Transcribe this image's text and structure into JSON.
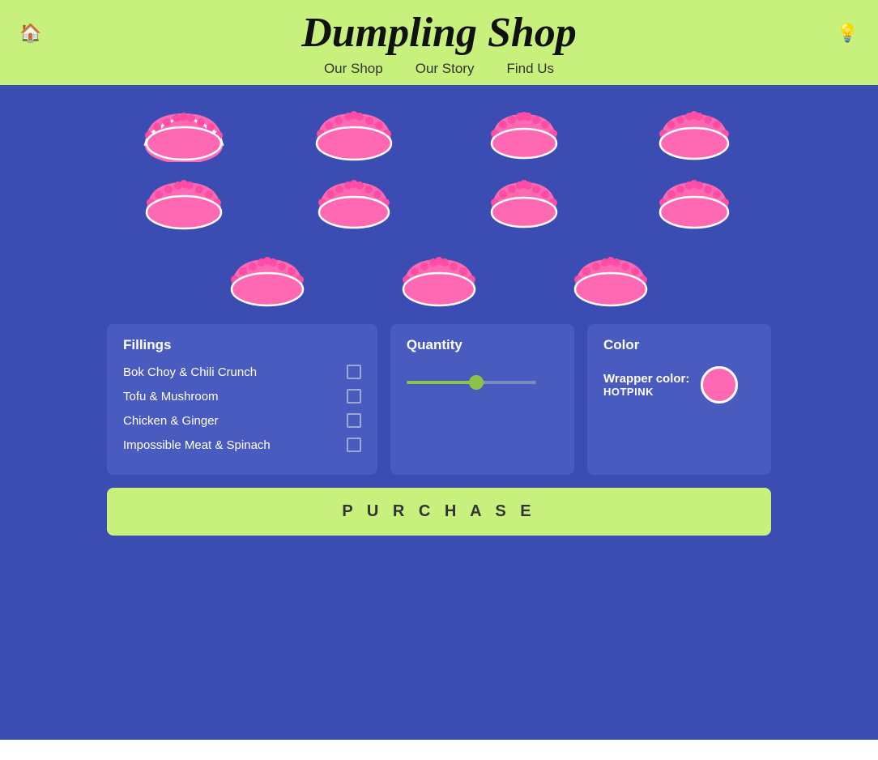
{
  "header": {
    "title": "Dumpling Shop",
    "nav": [
      {
        "label": "Our Shop",
        "href": "#"
      },
      {
        "label": "Our Story",
        "href": "#"
      },
      {
        "label": "Find Us",
        "href": "#"
      }
    ],
    "home_icon": "🏠",
    "light_icon": "💡"
  },
  "dumplings": {
    "count": 11,
    "color": "hotpink"
  },
  "fillings": {
    "title": "Fillings",
    "items": [
      {
        "label": "Bok Choy & Chili Crunch",
        "checked": false
      },
      {
        "label": "Tofu & Mushroom",
        "checked": false
      },
      {
        "label": "Chicken & Ginger",
        "checked": false
      },
      {
        "label": "Impossible Meat & Spinach",
        "checked": false
      }
    ]
  },
  "quantity": {
    "title": "Quantity",
    "value": 7,
    "min": 1,
    "max": 12
  },
  "color": {
    "title": "Color",
    "wrapper_color_label": "Wrapper color:",
    "color_name": "HOTPINK",
    "hex": "#FF69B4"
  },
  "purchase": {
    "label": "P U R C H A S E"
  }
}
